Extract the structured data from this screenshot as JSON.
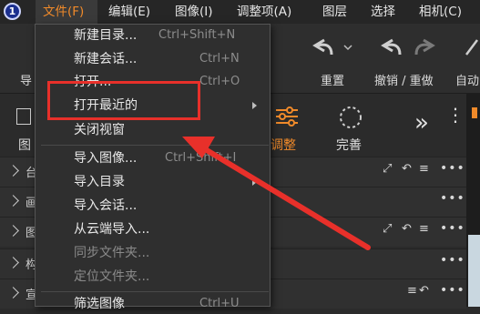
{
  "menubar": {
    "logo_text": "1",
    "items": [
      "文件(F)",
      "编辑(E)",
      "图像(I)",
      "调整项(A)",
      "图层",
      "选择",
      "相机(C)"
    ]
  },
  "toolbar": {
    "left_partial_label": "导",
    "reset_label": "重置",
    "undo_redo_label": "撤销 / 重做",
    "auto_partial_label": "自动"
  },
  "tabs": {
    "left_partial_label": "图",
    "adjust_label": "调整",
    "finish_label": "完善"
  },
  "panel_rows": [
    "台",
    "画",
    "图",
    "构",
    "宣"
  ],
  "file_menu": {
    "items": [
      {
        "label": "新建目录...",
        "shortcut": "Ctrl+Shift+N"
      },
      {
        "label": "新建会话...",
        "shortcut": "Ctrl+N"
      },
      {
        "label": "打开...",
        "shortcut": "Ctrl+O"
      },
      {
        "label": "打开最近的",
        "shortcut": ""
      },
      {
        "label": "关闭视窗",
        "shortcut": ""
      },
      {
        "label": "导入图像...",
        "shortcut": "Ctrl+Shift+I"
      },
      {
        "label": "导入目录",
        "shortcut": ""
      },
      {
        "label": "导入会话...",
        "shortcut": ""
      },
      {
        "label": "从云端导入...",
        "shortcut": ""
      },
      {
        "label": "同步文件夹...",
        "shortcut": ""
      },
      {
        "label": "定位文件夹...",
        "shortcut": ""
      },
      {
        "label": "筛选图像",
        "shortcut": "Ctrl+U"
      }
    ]
  },
  "colors": {
    "accent": "#f08a2a",
    "annotation": "#e8302a"
  }
}
